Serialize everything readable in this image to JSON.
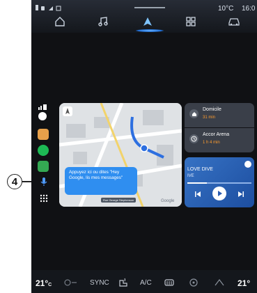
{
  "status": {
    "temperature": "10°C",
    "time": "16:0"
  },
  "nav_icons": [
    "home-icon",
    "music-icon",
    "navigation-icon",
    "apps-grid-icon",
    "car-icon"
  ],
  "sidebar_apps": [
    "waze-app-icon",
    "spotify-app-icon",
    "maps-app-icon",
    "microphone-icon",
    "app-launcher-icon"
  ],
  "map": {
    "assistant_prompt": "Appuyez ici ou dites \"Hey Google, lis mes messages\"",
    "street_label": "Rue George Stephenson",
    "brand": "Google"
  },
  "destinations": [
    {
      "name": "Domicile",
      "eta": "31 min"
    },
    {
      "name": "Accor Arena",
      "eta": "1 h 4 min"
    }
  ],
  "media": {
    "title": "LOVE DIVE",
    "artist": "IVE",
    "progress": 0.3
  },
  "climate": {
    "left_temp": "21°",
    "left_unit": "C",
    "sync_label": "SYNC",
    "ac_label": "A/C",
    "right_temp": "21°"
  },
  "callout": {
    "label": "4"
  },
  "colors": {
    "accent": "#2f8ef0",
    "eta": "#ff9d2e",
    "route": "#2d6fe0"
  }
}
